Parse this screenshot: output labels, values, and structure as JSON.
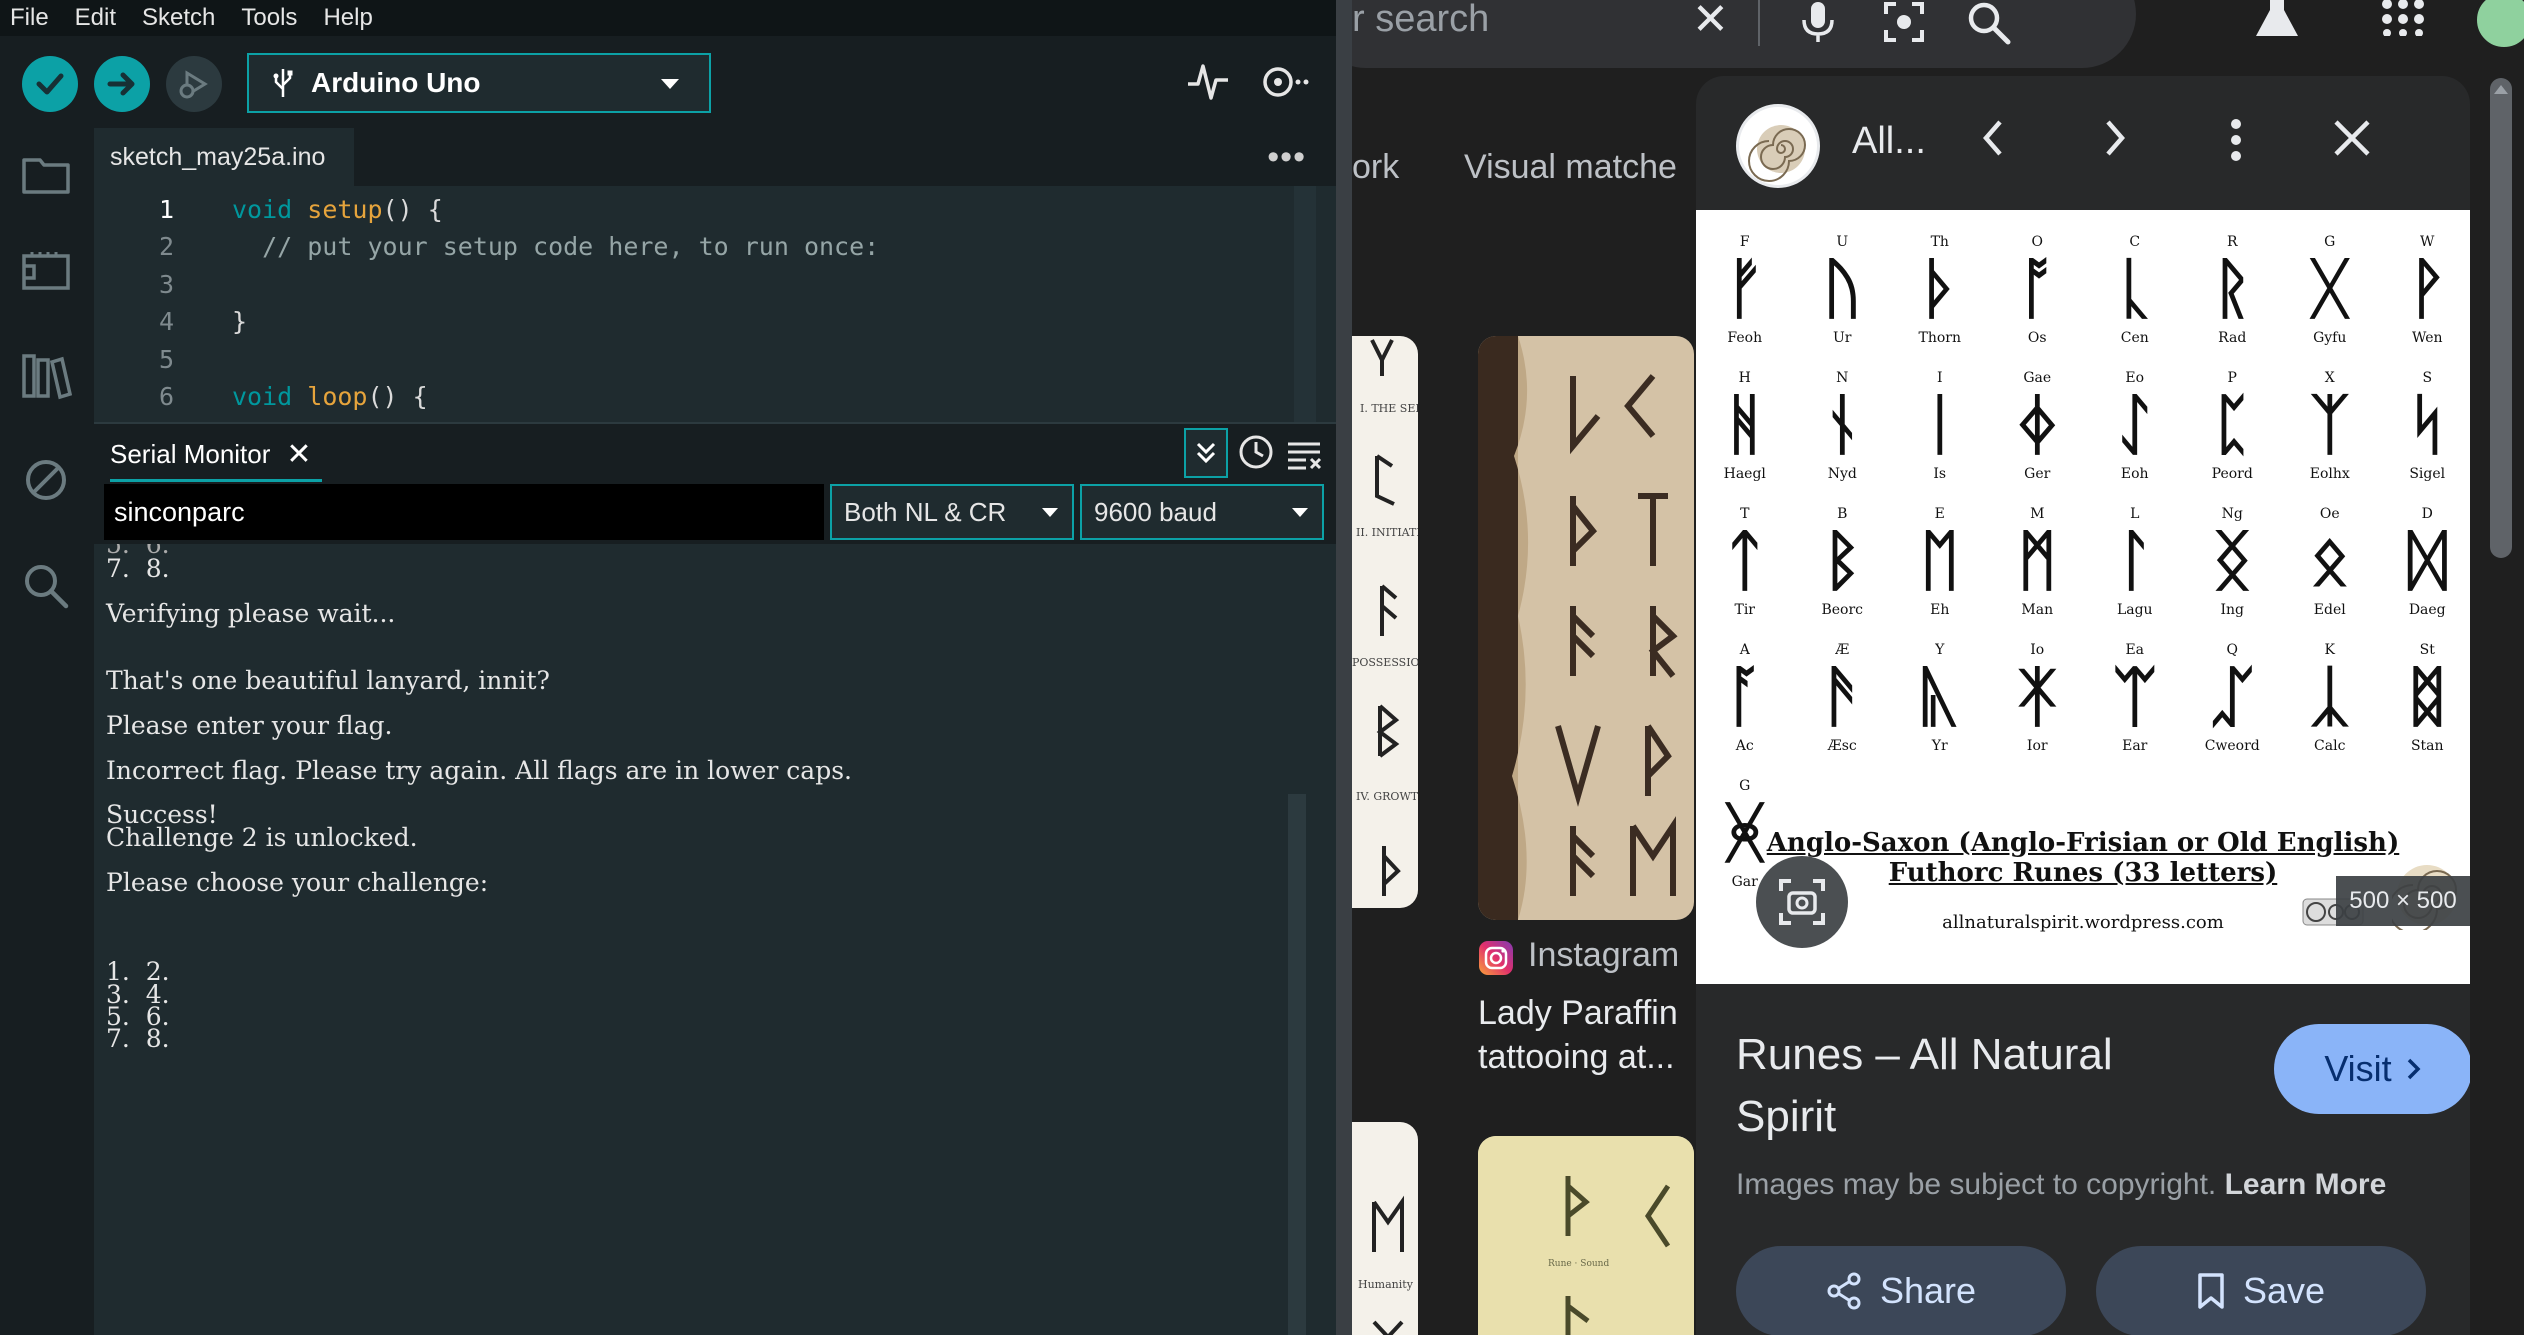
{
  "ide": {
    "menu": [
      "File",
      "Edit",
      "Sketch",
      "Tools",
      "Help"
    ],
    "board": "Arduino Uno",
    "file_tab": "sketch_may25a.ino",
    "code": [
      {
        "num": "1",
        "parts": [
          {
            "t": "void",
            "c": "kw"
          },
          {
            "t": " "
          },
          {
            "t": "setup",
            "c": "fn"
          },
          {
            "t": "() {"
          }
        ]
      },
      {
        "num": "2",
        "parts": [
          {
            "t": "  // put your setup code here, to run once:",
            "c": "cm"
          }
        ]
      },
      {
        "num": "3",
        "parts": []
      },
      {
        "num": "4",
        "parts": [
          {
            "t": "}"
          }
        ]
      },
      {
        "num": "5",
        "parts": []
      },
      {
        "num": "6",
        "parts": [
          {
            "t": "void",
            "c": "kw"
          },
          {
            "t": " "
          },
          {
            "t": "loop",
            "c": "fn"
          },
          {
            "t": "() {"
          }
        ]
      }
    ],
    "serial": {
      "tab_label": "Serial Monitor",
      "input_value": "sinconparc",
      "line_ending": "Both NL & CR",
      "baud": "9600 baud",
      "output": [
        "7.  8.",
        "",
        "Verifying please wait...",
        "",
        "",
        "That's one beautiful lanyard, innit?",
        "",
        "Please enter your flag.",
        "",
        "Incorrect flag. Please try again. All flags are in lower caps.",
        "",
        "Success!",
        "Challenge 2 is unlocked.",
        "",
        "Please choose your challenge:",
        "",
        "",
        "",
        "1.  2.",
        "3.  4.",
        "5.  6.",
        "7.  8."
      ]
    }
  },
  "browser": {
    "search_placeholder": "r search",
    "filter_tabs": [
      "ork",
      "Visual matche"
    ],
    "result": {
      "source": "Instagram",
      "title_line1": "Lady Paraffin",
      "title_line2": "tattooing at..."
    },
    "panel": {
      "source": "All...",
      "image_caption_line1": "Anglo-Saxon (Anglo-Frisian or Old English)",
      "image_caption_line2": "Futhorc Runes (33 letters)",
      "image_credit": "allnaturalspirit.wordpress.com",
      "dimensions": "500 × 500",
      "title": "Runes – All Natural Spirit",
      "visit_label": "Visit",
      "copyright_text": "Images may be subject to copyright.",
      "learn_more": "Learn More",
      "share_label": "Share",
      "save_label": "Save"
    },
    "runes": [
      {
        "top": "F",
        "glyph": "ᚠ",
        "name": "Feoh"
      },
      {
        "top": "U",
        "glyph": "ᚢ",
        "name": "Ur"
      },
      {
        "top": "Th",
        "glyph": "ᚦ",
        "name": "Thorn"
      },
      {
        "top": "O",
        "glyph": "ᚩ",
        "name": "Os"
      },
      {
        "top": "C",
        "glyph": "ᚳ",
        "name": "Cen"
      },
      {
        "top": "R",
        "glyph": "ᚱ",
        "name": "Rad"
      },
      {
        "top": "G",
        "glyph": "ᚷ",
        "name": "Gyfu"
      },
      {
        "top": "W",
        "glyph": "ᚹ",
        "name": "Wen"
      },
      {
        "top": "H",
        "glyph": "ᚻ",
        "name": "Haegl"
      },
      {
        "top": "N",
        "glyph": "ᚾ",
        "name": "Nyd"
      },
      {
        "top": "I",
        "glyph": "ᛁ",
        "name": "Is"
      },
      {
        "top": "Gae",
        "glyph": "ᛄ",
        "name": "Ger"
      },
      {
        "top": "Eo",
        "glyph": "ᛇ",
        "name": "Eoh"
      },
      {
        "top": "P",
        "glyph": "ᛈ",
        "name": "Peord"
      },
      {
        "top": "X",
        "glyph": "ᛉ",
        "name": "Eolhx"
      },
      {
        "top": "S",
        "glyph": "ᛋ",
        "name": "Sigel"
      },
      {
        "top": "T",
        "glyph": "ᛏ",
        "name": "Tir"
      },
      {
        "top": "B",
        "glyph": "ᛒ",
        "name": "Beorc"
      },
      {
        "top": "E",
        "glyph": "ᛖ",
        "name": "Eh"
      },
      {
        "top": "M",
        "glyph": "ᛗ",
        "name": "Man"
      },
      {
        "top": "L",
        "glyph": "ᛚ",
        "name": "Lagu"
      },
      {
        "top": "Ng",
        "glyph": "ᛝ",
        "name": "Ing"
      },
      {
        "top": "Oe",
        "glyph": "ᛟ",
        "name": "Edel"
      },
      {
        "top": "D",
        "glyph": "ᛞ",
        "name": "Daeg"
      },
      {
        "top": "A",
        "glyph": "ᚪ",
        "name": "Ac"
      },
      {
        "top": "Æ",
        "glyph": "ᚫ",
        "name": "Æsc"
      },
      {
        "top": "Y",
        "glyph": "ᚣ",
        "name": "Yr"
      },
      {
        "top": "Io",
        "glyph": "ᛡ",
        "name": "Ior"
      },
      {
        "top": "Ea",
        "glyph": "ᛠ",
        "name": "Ear"
      },
      {
        "top": "Q",
        "glyph": "ᛢ",
        "name": "Cweord"
      },
      {
        "top": "K",
        "glyph": "ᛣ",
        "name": "Calc"
      },
      {
        "top": "St",
        "glyph": "ᛥ",
        "name": "Stan"
      },
      {
        "top": "G",
        "glyph": "ᚸ",
        "name": "Gar"
      }
    ]
  }
}
